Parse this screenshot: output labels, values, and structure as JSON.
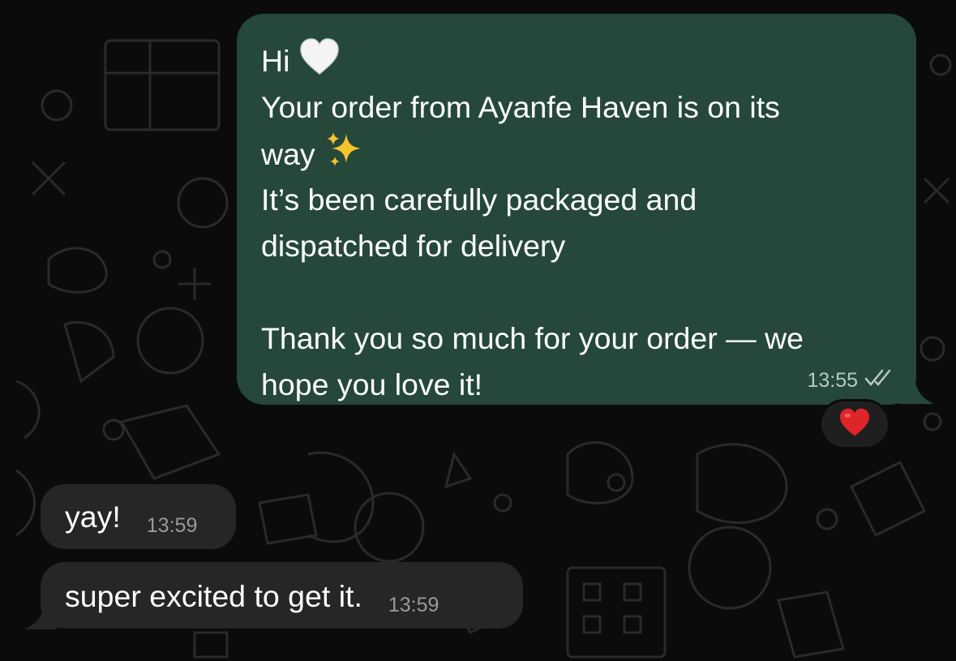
{
  "chat": {
    "outgoing": {
      "lines": [
        "Hi",
        "Your order from Ayanfe Haven is on its",
        "way",
        "It’s been carefully packaged and",
        "dispatched for delivery",
        "",
        "Thank you so much for your order — we",
        "hope you love it!"
      ],
      "emojis": [
        "white-heart-icon",
        "sparkles-icon"
      ],
      "time": "13:55",
      "status_icon": "double-check-icon",
      "reaction_icon": "red-heart-icon"
    },
    "incoming": [
      {
        "text": "yay!",
        "time": "13:59"
      },
      {
        "text": "super excited to get it.",
        "time": "13:59"
      }
    ]
  },
  "colors": {
    "background": "#0b0b0b",
    "outgoing_bubble": "#25483a",
    "incoming_bubble": "#262626",
    "reaction_heart": "#e0242b"
  }
}
